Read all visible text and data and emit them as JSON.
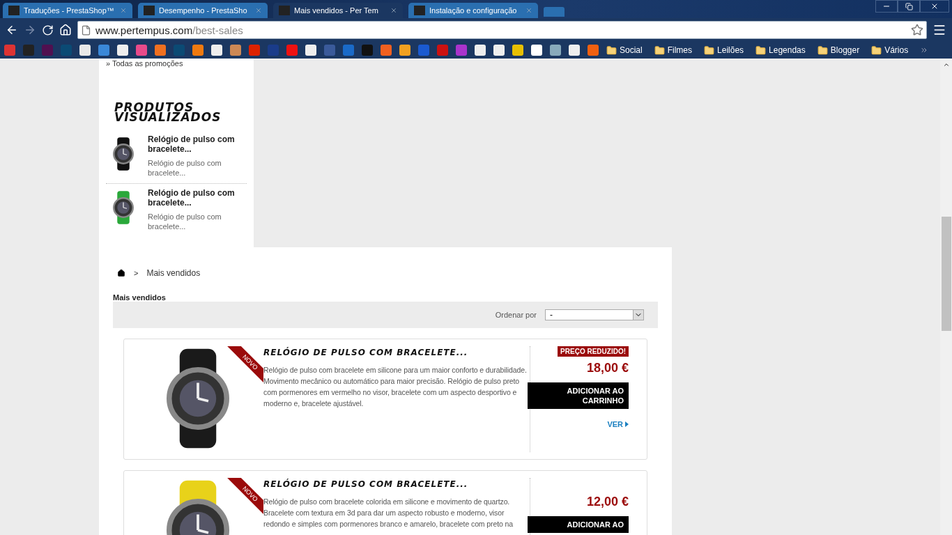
{
  "tabs": [
    {
      "title": "Traduções - PrestaShop™",
      "selected": false
    },
    {
      "title": "Desempenho - PrestaSho",
      "selected": false
    },
    {
      "title": "Mais vendidos - Per Tem",
      "selected": true
    },
    {
      "title": "Instalação e configuração",
      "selected": false
    }
  ],
  "address": {
    "host": "www.pertempus.com",
    "path": "/best-sales"
  },
  "bookmark_folders": [
    "Social",
    "Filmes",
    "Leilões",
    "Legendas",
    "Blogger",
    "Vários"
  ],
  "sidebar": {
    "link": "» Todas as promoções",
    "heading": "PRODUTOS VISUALIZADOS",
    "items": [
      {
        "title": "Relógio de pulso com bracelete...",
        "description": "Relógio de pulso com bracelete..."
      },
      {
        "title": "Relógio de pulso com bracelete...",
        "description": "Relógio de pulso com bracelete..."
      }
    ]
  },
  "breadcrumb": {
    "separator": ">",
    "current": "Mais vendidos"
  },
  "heading": "Mais vendidos",
  "sort": {
    "label": "Ordenar por",
    "value": "-"
  },
  "products": [
    {
      "title": "RELÓGIO DE PULSO COM BRACELETE...",
      "ribbon": "NOVO",
      "description": "Relógio de pulso com bracelete em silicone para um maior conforto e durabilidade. Movimento mecânico ou automático para maior precisão. Relógio de pulso preto com pormenores em vermelho no visor, bracelete com um aspecto desportivo e moderno e, bracelete ajustável.",
      "reduced_label": "PREÇO REDUZIDO!",
      "price": "18,00 €",
      "cart": "ADICIONAR AO CARRINHO",
      "view": "VER"
    },
    {
      "title": "RELÓGIO DE PULSO COM BRACELETE...",
      "ribbon": "NOVO",
      "description": "Relógio de pulso com bracelete colorida em silicone e movimento de quartzo. Bracelete com textura em 3d para dar um aspecto robusto e moderno, visor redondo e simples com pormenores branco e amarelo, bracelete com preto na",
      "price": "12,00 €",
      "cart": "ADICIONAR AO"
    }
  ]
}
